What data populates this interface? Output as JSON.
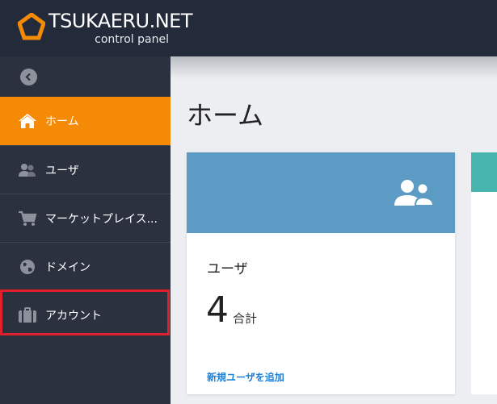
{
  "header": {
    "brand_title": "TSUKAERU.NET",
    "brand_subtitle": "control panel",
    "logo_icon": "pentagon-logo-icon"
  },
  "sidebar": {
    "collapse_icon": "chevron-left-icon",
    "items": [
      {
        "label": "ホーム",
        "icon": "home-icon",
        "active": true
      },
      {
        "label": "ユーザ",
        "icon": "users-icon",
        "active": false
      },
      {
        "label": "マーケットプレイス...",
        "icon": "cart-icon",
        "active": false
      },
      {
        "label": "ドメイン",
        "icon": "globe-icon",
        "active": false
      },
      {
        "label": "アカウント",
        "icon": "briefcase-icon",
        "active": false
      }
    ]
  },
  "main": {
    "page_title": "ホーム",
    "user_card": {
      "title": "ユーザ",
      "count": "4",
      "count_label": "合計",
      "link": "新規ユーザを追加",
      "header_icon": "users-icon"
    }
  },
  "colors": {
    "header_bg": "#232a3a",
    "sidebar_bg": "#2c3140",
    "active_item": "#f58a07",
    "card_header": "#5c9bc3",
    "card2_header": "#47b5ad",
    "link": "#1e7fd6",
    "highlight": "#e0202a"
  }
}
